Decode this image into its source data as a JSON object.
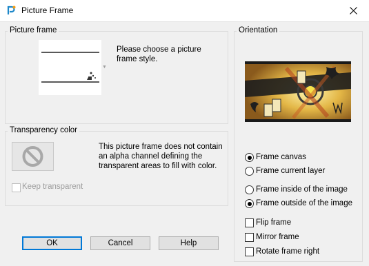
{
  "window": {
    "title": "Picture Frame",
    "app_icon": "paintshop-pro-icon",
    "close_icon": "close-icon"
  },
  "picture_frame": {
    "group_label": "Picture frame",
    "instruction": "Please choose a picture frame style."
  },
  "transparency": {
    "group_label": "Transparency color",
    "message": "This picture frame does not contain an alpha channel defining the transparent areas to fill with color.",
    "swatch_icon": "prohibited-icon",
    "keep_transparent_label": "Keep transparent",
    "keep_transparent_checked": false,
    "keep_transparent_enabled": false
  },
  "orientation": {
    "group_label": "Orientation",
    "options_group1": [
      {
        "label": "Frame canvas",
        "checked": true
      },
      {
        "label": "Frame current layer",
        "checked": false
      }
    ],
    "options_group2": [
      {
        "label": "Frame inside of the image",
        "checked": false
      },
      {
        "label": "Frame outside of the image",
        "checked": true
      }
    ],
    "checkboxes": [
      {
        "label": "Flip frame",
        "checked": false
      },
      {
        "label": "Mirror frame",
        "checked": false
      },
      {
        "label": "Rotate frame right",
        "checked": false
      }
    ]
  },
  "buttons": {
    "ok": "OK",
    "cancel": "Cancel",
    "help": "Help"
  },
  "colors": {
    "accent": "#0078d7",
    "dialog_bg": "#f0f0f0"
  }
}
